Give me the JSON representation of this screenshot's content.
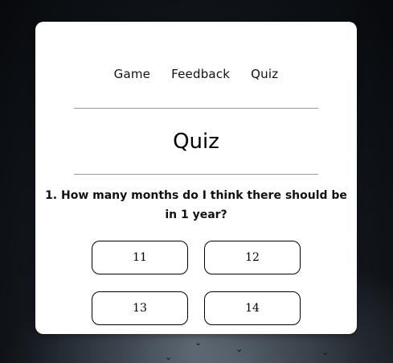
{
  "nav": {
    "items": [
      {
        "label": "Game"
      },
      {
        "label": "Feedback"
      },
      {
        "label": "Quiz"
      }
    ]
  },
  "quiz": {
    "title": "Quiz",
    "question": "1. How many months do I think there should be in 1 year?",
    "answers": [
      "11",
      "12",
      "13",
      "14"
    ]
  },
  "colors": {
    "card_background": "#ffffff",
    "page_background": "#07090c",
    "divider": "#9a9a9a",
    "button_border": "#000000"
  }
}
